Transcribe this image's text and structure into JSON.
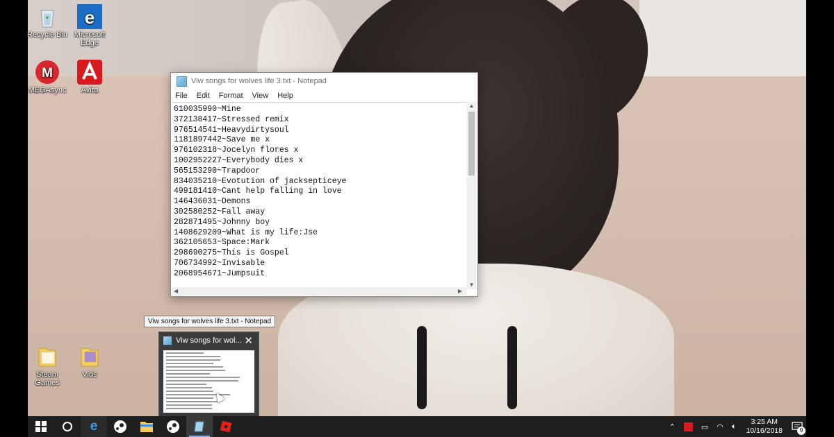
{
  "desktop_icons": {
    "recycle_bin": "Recycle Bin",
    "edge": "Microsoft Edge",
    "megasync": "MEGAsync",
    "avira": "Avira",
    "steam_games": "Steam Games",
    "vids": "Vids"
  },
  "notepad": {
    "title": "Viw songs for wolves life 3.txt - Notepad",
    "menu": [
      "File",
      "Edit",
      "Format",
      "View",
      "Help"
    ],
    "lines": [
      "610035990~Mine",
      "372138417~Stressed remix",
      "976514541~Heavydirtysoul",
      "1181897442~Save me x",
      "976102318~Jocelyn flores x",
      "1002952227~Everybody dies x",
      "565153290~Trapdoor",
      "834035210~Evotution of jacksepticeye",
      "499181410~Cant help falling in love",
      "146436031~Demons",
      "302580252~Fall away",
      "282871495~Johnny boy",
      "1408629209~What is my life:Jse",
      "362105653~Space:Mark",
      "298690275~This is Gospel",
      "706734992~Invisable",
      "2068954671~Jumpsuit"
    ]
  },
  "tooltip": "Viw songs for wolves life 3.txt - Notepad",
  "thumbnail": {
    "title": "Viw songs for wol..."
  },
  "taskbar": {
    "time": "3:25 AM",
    "date": "10/16/2018",
    "notification_count": "9",
    "accent": "#7fb2e8"
  }
}
